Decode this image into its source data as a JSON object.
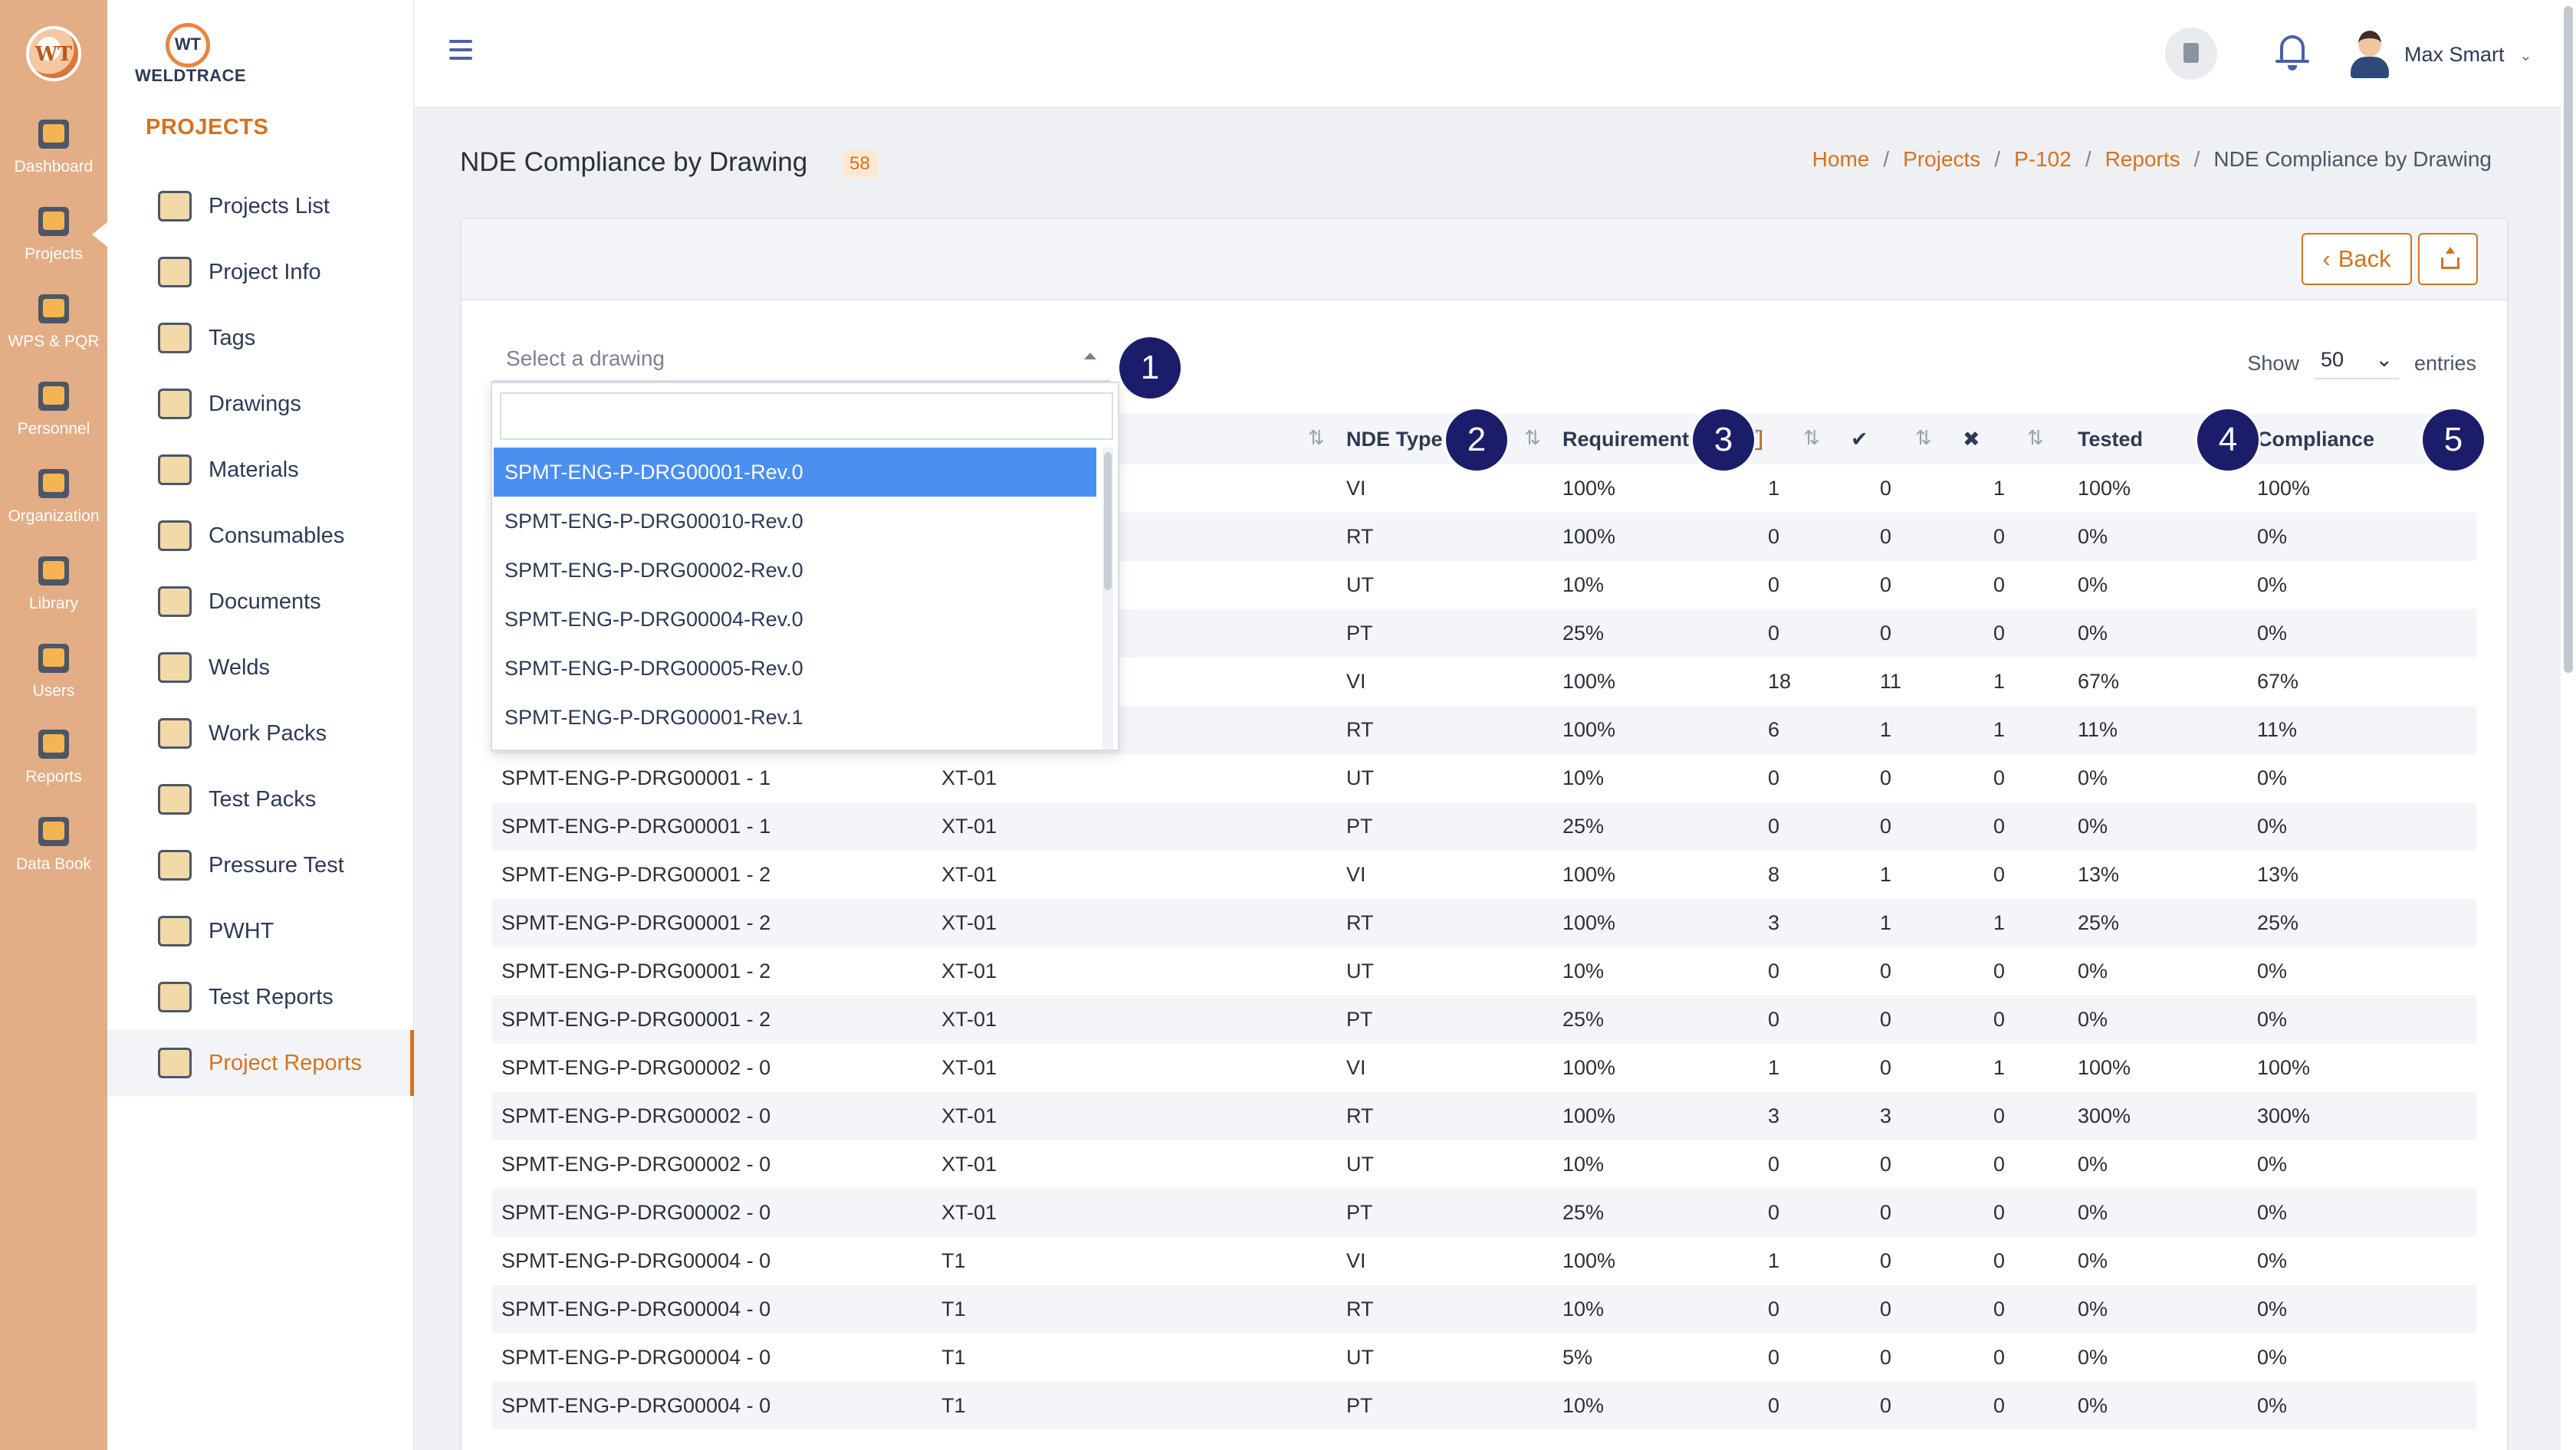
{
  "rail": {
    "logo_text": "WT",
    "items": [
      {
        "label": "Dashboard",
        "icon": "dashboard-icon"
      },
      {
        "label": "Projects",
        "icon": "projects-folder-icon"
      },
      {
        "label": "WPS & PQR",
        "icon": "wps-pqr-icon"
      },
      {
        "label": "Personnel",
        "icon": "welder-personnel-icon"
      },
      {
        "label": "Organization",
        "icon": "organization-icon"
      },
      {
        "label": "Library",
        "icon": "library-icon"
      },
      {
        "label": "Users",
        "icon": "users-icon"
      },
      {
        "label": "Reports",
        "icon": "reports-icon"
      },
      {
        "label": "Data Book",
        "icon": "data-book-icon"
      }
    ]
  },
  "brand": {
    "mark": "WT",
    "name": "WELDTRACE"
  },
  "sidebar": {
    "section_title": "PROJECTS",
    "items": [
      {
        "label": "Projects List",
        "icon": "projects-list-icon"
      },
      {
        "label": "Project Info",
        "icon": "project-info-icon"
      },
      {
        "label": "Tags",
        "icon": "tag-icon"
      },
      {
        "label": "Drawings",
        "icon": "drawings-icon"
      },
      {
        "label": "Materials",
        "icon": "materials-icon"
      },
      {
        "label": "Consumables",
        "icon": "consumables-icon"
      },
      {
        "label": "Documents",
        "icon": "documents-icon"
      },
      {
        "label": "Welds",
        "icon": "welds-icon"
      },
      {
        "label": "Work Packs",
        "icon": "work-packs-icon"
      },
      {
        "label": "Test Packs",
        "icon": "test-packs-icon"
      },
      {
        "label": "Pressure Test",
        "icon": "pressure-test-icon"
      },
      {
        "label": "PWHT",
        "icon": "pwht-icon"
      },
      {
        "label": "Test Reports",
        "icon": "test-reports-icon"
      },
      {
        "label": "Project Reports",
        "icon": "project-reports-icon",
        "active": true
      }
    ]
  },
  "header": {
    "user_name": "Max Smart"
  },
  "page": {
    "title": "NDE Compliance by Drawing",
    "count": "58",
    "breadcrumb": [
      "Home",
      "Projects",
      "P-102",
      "Reports"
    ],
    "breadcrumb_current": "NDE Compliance by Drawing"
  },
  "toolbar": {
    "back_label": "Back"
  },
  "filter": {
    "select_placeholder": "Select a drawing",
    "show_label": "Show",
    "entries_value": "50",
    "entries_label": "entries"
  },
  "dropdown": {
    "options": [
      "SPMT-ENG-P-DRG00001-Rev.0",
      "SPMT-ENG-P-DRG00010-Rev.0",
      "SPMT-ENG-P-DRG00002-Rev.0",
      "SPMT-ENG-P-DRG00004-Rev.0",
      "SPMT-ENG-P-DRG00005-Rev.0",
      "SPMT-ENG-P-DRG00001-Rev.1"
    ],
    "selected_index": 0
  },
  "table": {
    "headers": {
      "nde_type": "NDE Type",
      "requirement": "Requirement",
      "tested": "Tested",
      "compliance": "Compliance"
    },
    "rows": [
      [
        "",
        "",
        "VI",
        "100%",
        "1",
        "0",
        "1",
        "100%",
        "100%"
      ],
      [
        "",
        "",
        "RT",
        "100%",
        "0",
        "0",
        "0",
        "0%",
        "0%"
      ],
      [
        "",
        "",
        "UT",
        "10%",
        "0",
        "0",
        "0",
        "0%",
        "0%"
      ],
      [
        "",
        "",
        "PT",
        "25%",
        "0",
        "0",
        "0",
        "0%",
        "0%"
      ],
      [
        "",
        "",
        "VI",
        "100%",
        "18",
        "11",
        "1",
        "67%",
        "67%"
      ],
      [
        "",
        "",
        "RT",
        "100%",
        "6",
        "1",
        "1",
        "11%",
        "11%"
      ],
      [
        "SPMT-ENG-P-DRG00001 - 1",
        "XT-01",
        "UT",
        "10%",
        "0",
        "0",
        "0",
        "0%",
        "0%"
      ],
      [
        "SPMT-ENG-P-DRG00001 - 1",
        "XT-01",
        "PT",
        "25%",
        "0",
        "0",
        "0",
        "0%",
        "0%"
      ],
      [
        "SPMT-ENG-P-DRG00001 - 2",
        "XT-01",
        "VI",
        "100%",
        "8",
        "1",
        "0",
        "13%",
        "13%"
      ],
      [
        "SPMT-ENG-P-DRG00001 - 2",
        "XT-01",
        "RT",
        "100%",
        "3",
        "1",
        "1",
        "25%",
        "25%"
      ],
      [
        "SPMT-ENG-P-DRG00001 - 2",
        "XT-01",
        "UT",
        "10%",
        "0",
        "0",
        "0",
        "0%",
        "0%"
      ],
      [
        "SPMT-ENG-P-DRG00001 - 2",
        "XT-01",
        "PT",
        "25%",
        "0",
        "0",
        "0",
        "0%",
        "0%"
      ],
      [
        "SPMT-ENG-P-DRG00002 - 0",
        "XT-01",
        "VI",
        "100%",
        "1",
        "0",
        "1",
        "100%",
        "100%"
      ],
      [
        "SPMT-ENG-P-DRG00002 - 0",
        "XT-01",
        "RT",
        "100%",
        "3",
        "3",
        "0",
        "300%",
        "300%"
      ],
      [
        "SPMT-ENG-P-DRG00002 - 0",
        "XT-01",
        "UT",
        "10%",
        "0",
        "0",
        "0",
        "0%",
        "0%"
      ],
      [
        "SPMT-ENG-P-DRG00002 - 0",
        "XT-01",
        "PT",
        "25%",
        "0",
        "0",
        "0",
        "0%",
        "0%"
      ],
      [
        "SPMT-ENG-P-DRG00004 - 0",
        "T1",
        "VI",
        "100%",
        "1",
        "0",
        "0",
        "0%",
        "0%"
      ],
      [
        "SPMT-ENG-P-DRG00004 - 0",
        "T1",
        "RT",
        "10%",
        "0",
        "0",
        "0",
        "0%",
        "0%"
      ],
      [
        "SPMT-ENG-P-DRG00004 - 0",
        "T1",
        "UT",
        "5%",
        "0",
        "0",
        "0",
        "0%",
        "0%"
      ],
      [
        "SPMT-ENG-P-DRG00004 - 0",
        "T1",
        "PT",
        "10%",
        "0",
        "0",
        "0",
        "0%",
        "0%"
      ]
    ]
  },
  "markers": [
    "1",
    "2",
    "3",
    "4",
    "5"
  ],
  "colors": {
    "accent": "#d4731f",
    "marker": "#1b1d6b",
    "selected": "#4a8ff0"
  }
}
